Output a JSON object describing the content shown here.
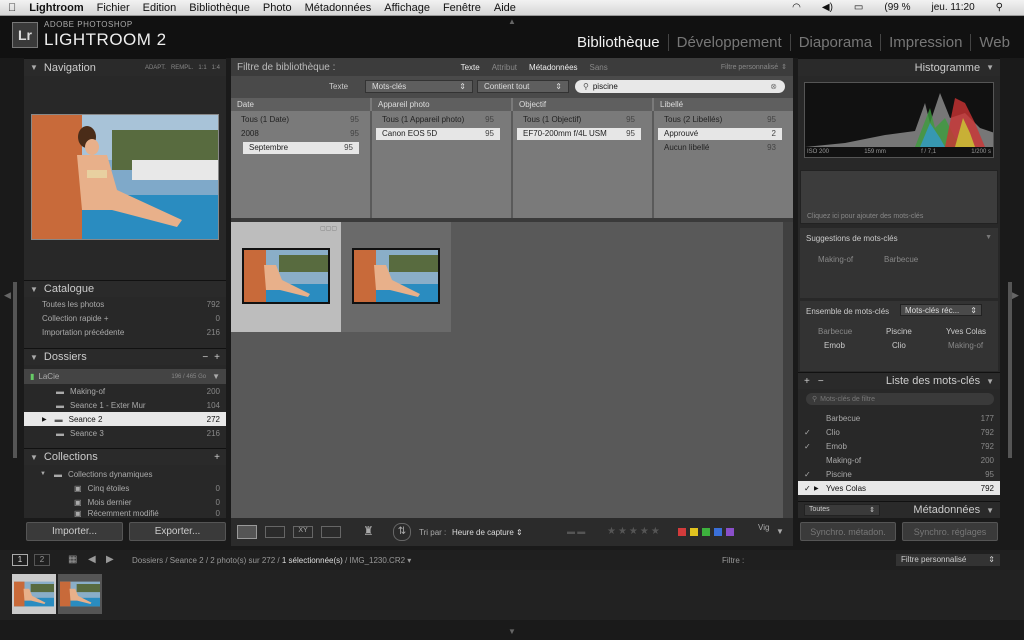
{
  "menubar": {
    "app": "Lightroom",
    "items": [
      "Fichier",
      "Edition",
      "Bibliothèque",
      "Photo",
      "Métadonnées",
      "Affichage",
      "Fenêtre",
      "Aide"
    ],
    "battery": "(99 %",
    "clock": "jeu. 11:20"
  },
  "header": {
    "logo_letters": "Lr",
    "logo_small": "ADOBE PHOTOSHOP",
    "logo_big": "LIGHTROOM 2",
    "modules": [
      "Bibliothèque",
      "Développement",
      "Diaporama",
      "Impression",
      "Web"
    ],
    "active_module": "Bibliothèque"
  },
  "left": {
    "navigator": {
      "title": "Navigation",
      "opts": [
        "ADAPT.",
        "REMPL.",
        "1:1",
        "1:4"
      ]
    },
    "catalog": {
      "title": "Catalogue",
      "items": [
        {
          "label": "Toutes les photos",
          "count": "792"
        },
        {
          "label": "Collection rapide +",
          "count": "0"
        },
        {
          "label": "Importation précédente",
          "count": "216"
        }
      ]
    },
    "folders": {
      "title": "Dossiers",
      "volume": "LaCie",
      "volume_info": "196 / 465 Go",
      "items": [
        {
          "label": "Making-of",
          "count": "200"
        },
        {
          "label": "Seance 1 - Exter Mur",
          "count": "104"
        },
        {
          "label": "Seance 2",
          "count": "272"
        },
        {
          "label": "Seance 3",
          "count": "216"
        }
      ]
    },
    "collections": {
      "title": "Collections",
      "group": "Collections dynamiques",
      "items": [
        {
          "label": "Cinq étoiles",
          "count": "0"
        },
        {
          "label": "Mois dernier",
          "count": "0"
        },
        {
          "label": "Récemment modifié",
          "count": "0"
        }
      ]
    },
    "import_label": "Importer...",
    "export_label": "Exporter..."
  },
  "filter": {
    "title": "Filtre de bibliothèque :",
    "tabs": [
      "Texte",
      "Attribut",
      "Métadonnées",
      "Sans"
    ],
    "active_tab": "Métadonnées",
    "preset": "Filtre personnalisé",
    "text_label": "Texte",
    "field": "Mots-clés",
    "rule": "Contient tout",
    "search_value": "piscine",
    "columns": [
      {
        "header": "Date",
        "rows": [
          {
            "label": "Tous (1 Date)",
            "count": "95"
          },
          {
            "label": "2008",
            "count": "95"
          },
          {
            "label": "Septembre",
            "count": "95"
          }
        ]
      },
      {
        "header": "Appareil photo",
        "rows": [
          {
            "label": "Tous (1 Appareil photo)",
            "count": "95"
          },
          {
            "label": "Canon EOS 5D",
            "count": "95"
          }
        ]
      },
      {
        "header": "Objectif",
        "rows": [
          {
            "label": "Tous (1 Objectif)",
            "count": "95"
          },
          {
            "label": "EF70-200mm f/4L USM",
            "count": "95"
          }
        ]
      },
      {
        "header": "Libellé",
        "rows": [
          {
            "label": "Tous (2 Libellés)",
            "count": "95"
          },
          {
            "label": "Approuvé",
            "count": "2"
          },
          {
            "label": "Aucun libellé",
            "count": "93"
          }
        ]
      }
    ]
  },
  "toolbar": {
    "sort_label": "Tri par :",
    "sort_value": "Heure de capture",
    "vig": "Vig",
    "label_colors": [
      "#d23b3b",
      "#e0c21f",
      "#3db13d",
      "#3a6fd8",
      "#8a4fc9"
    ]
  },
  "right": {
    "histogram": {
      "title": "Histogramme",
      "iso": "ISO 200",
      "focal": "159 mm",
      "aperture": "f / 7,1",
      "speed": "1/200 s"
    },
    "keyword_hint": "Cliquez ici pour ajouter des mots-clés",
    "suggestions": {
      "title": "Suggestions de mots-clés",
      "items": [
        "Making-of",
        "Barbecue"
      ]
    },
    "set": {
      "title": "Ensemble de mots-clés",
      "dropdown": "Mots-clés réc...",
      "items": [
        {
          "label": "Barbecue",
          "dim": true
        },
        {
          "label": "Piscine",
          "dim": false
        },
        {
          "label": "Yves Colas",
          "dim": false
        },
        {
          "label": "Emob",
          "dim": false
        },
        {
          "label": "Clio",
          "dim": false
        },
        {
          "label": "Making-of",
          "dim": true
        }
      ]
    },
    "list": {
      "title": "Liste des mots-clés",
      "filter_placeholder": "Mots-clés de filtre",
      "items": [
        {
          "label": "Barbecue",
          "count": "177",
          "check": ""
        },
        {
          "label": "Clio",
          "count": "792",
          "check": "✓"
        },
        {
          "label": "Emob",
          "count": "792",
          "check": "✓"
        },
        {
          "label": "Making-of",
          "count": "200",
          "check": ""
        },
        {
          "label": "Piscine",
          "count": "95",
          "check": "✓"
        },
        {
          "label": "Yves Colas",
          "count": "792",
          "check": "✓"
        }
      ]
    },
    "metadata_preset": "Toutes",
    "metadata_title": "Métadonnées",
    "sync_meta": "Synchro. métadon.",
    "sync_settings": "Synchro. réglages"
  },
  "filmstrip": {
    "pages": [
      "1",
      "2"
    ],
    "path": "Dossiers / Seance 2 / 2 photo(s) sur 272 /",
    "selected": "1 sélectionnée(s)",
    "filename": "/ IMG_1230.CR2",
    "filter_label": "Filtre :",
    "filter_value": "Filtre personnalisé"
  },
  "colors": {
    "accent": "#e8e8e8",
    "panel": "#282828",
    "center": "#595959"
  }
}
